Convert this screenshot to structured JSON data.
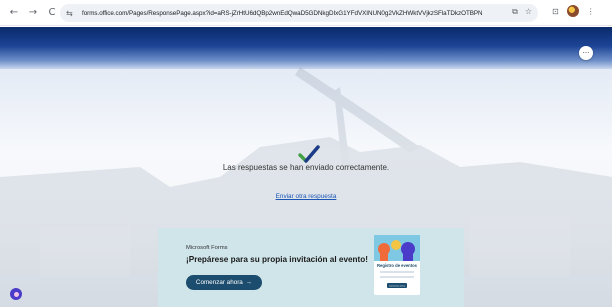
{
  "browser": {
    "back_icon": "←",
    "forward_icon": "→",
    "reload_icon": "C",
    "site_info_icon": "⇆",
    "url": "forms.office.com/Pages/ResponsePage.aspx?id=aRS-jZrHtU6dQBp2wnEdQwaD5GDNkgDIxG1YFdVXINUN0g2VkZHWktVVjkzSFlaTDkzOTBPNEQ4VS4u",
    "tab_icon": "⧉",
    "star_icon": "☆",
    "extensions_icon": "⊡",
    "menu_icon": "⋮"
  },
  "page": {
    "more_icon": "···",
    "success_message": "Las respuestas se han enviado correctamente.",
    "resend_link": "Enviar otra respuesta"
  },
  "promo": {
    "brand": "Microsoft Forms",
    "title": "¡Prepárese para su propia invitación al evento!",
    "button_label": "Comenzar ahora",
    "button_arrow": "→",
    "card_title": "Registro de eventos",
    "card_button": "Comenzar ahora"
  },
  "colors": {
    "header_dark": "#0a2a6a",
    "check_green": "#43a047",
    "check_blue": "#1e3a8a",
    "link": "#1a56b4",
    "promo_bg": "#cfe5ea",
    "promo_button": "#1c4d6e"
  }
}
